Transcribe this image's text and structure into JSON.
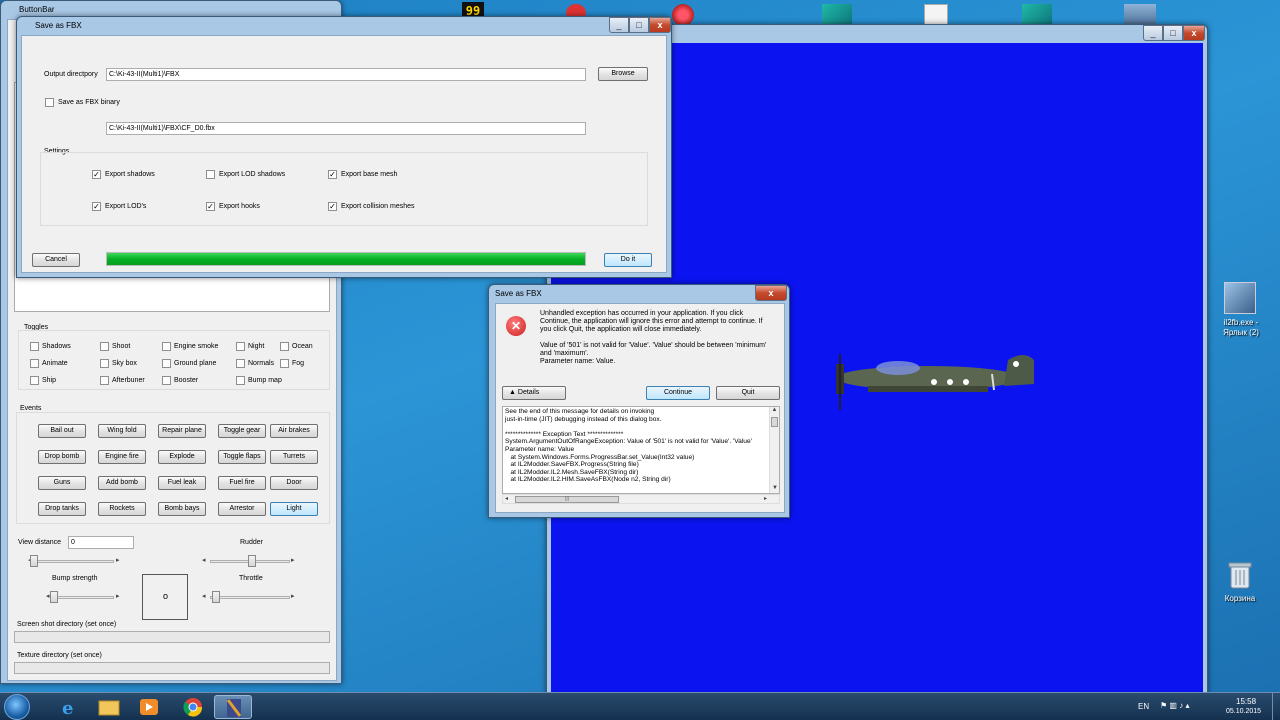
{
  "desktop": {
    "icons": [
      {
        "name": "il2fb.exe - Ярлык (2)",
        "label_line1": "il2fb.exe -",
        "label_line2": "Ярлык (2)"
      },
      {
        "name": "Корзина",
        "label": "Корзина"
      }
    ],
    "top_icon_99": "99"
  },
  "buttonbar": {
    "title": "ButtonBar",
    "toggles": {
      "title": "Toggles",
      "items": [
        "Shadows",
        "Shoot",
        "Engine smoke",
        "Night",
        "Ocean",
        "Animate",
        "Sky box",
        "Ground plane",
        "Normals",
        "Fog",
        "Ship",
        "Afterbuner",
        "Booster",
        "Bump map"
      ]
    },
    "events": {
      "title": "Events",
      "buttons": [
        "Bail out",
        "Wing fold",
        "Repair plane",
        "Toggle gear",
        "Air brakes",
        "Drop bomb",
        "Engine fire",
        "Explode",
        "Toggle flaps",
        "Turrets",
        "Guns",
        "Add bomb",
        "Fuel leak",
        "Fuel fire",
        "Door",
        "Drop tanks",
        "Rockets",
        "Bomb bays",
        "Arrestor",
        "Light"
      ]
    },
    "view_distance_label": "View distance",
    "view_distance_value": "0",
    "rudder_label": "Rudder",
    "bump_strength_label": "Bump strength",
    "throttle_label": "Throttle",
    "screenshot_dir_label": "Screen shot directory (set once)",
    "texture_dir_label": "Texture directory (set once)",
    "stick_glyph": "o"
  },
  "save_fbx": {
    "title": "Save as FBX",
    "output_dir_label": "Output directpory",
    "output_dir_value": "C:\\Ki-43-II(Multi1)\\FBX",
    "browse": "Browse",
    "binary_label": "Save as FBX binary",
    "file_path": "C:\\Ki-43-II(Multi1)\\FBX\\CF_D0.fbx",
    "settings_label": "Settings",
    "options": [
      {
        "label": "Export shadows",
        "checked": true
      },
      {
        "label": "Export LOD shadows",
        "checked": false
      },
      {
        "label": "Export base mesh",
        "checked": true
      },
      {
        "label": "Export LOD's",
        "checked": true
      },
      {
        "label": "Export hooks",
        "checked": true
      },
      {
        "label": "Export collision meshes",
        "checked": true
      }
    ],
    "cancel": "Cancel",
    "do_it": "Do it",
    "progress": 1.0,
    "progress_color": "#06b025"
  },
  "error_dialog": {
    "title": "Save as FBX",
    "message_l1": "Unhandled exception has occurred in your application. If you click",
    "message_l2": "Continue, the application will ignore this error and attempt to continue. If",
    "message_l3": "you click Quit, the application will close immediately.",
    "detail_l1": "Value of '501' is not valid for 'Value'. 'Value' should be between 'minimum'",
    "detail_l2": "and 'maximum'.",
    "detail_l3": "Parameter name: Value.",
    "details_btn": "Details",
    "continue_btn": "Continue",
    "quit_btn": "Quit",
    "details_text": [
      "See the end of this message for details on invoking",
      "just-in-time (JIT) debugging instead of this dialog box.",
      "",
      "************** Exception Text **************",
      "System.ArgumentOutOfRangeException: Value of '501' is not valid for 'Value'. 'Value'",
      "Parameter name: Value",
      "   at System.Windows.Forms.ProgressBar.set_Value(Int32 value)",
      "   at IL2Modder.SaveFBX.Progress(String file)",
      "   at IL2Modder.IL2.Mesh.SaveFBX(String dir)",
      "   at IL2Modder.IL2.HIM.SaveAsFBX(Node n2, String dir)"
    ],
    "scroll_thumb": "|||"
  },
  "viewer": {
    "bg_color": "#0b14f0"
  },
  "tray": {
    "lang": "EN",
    "time": "15:58",
    "date": "05.10.2015"
  },
  "colors": {
    "accent": "#06b025",
    "error": "#cc2222"
  }
}
